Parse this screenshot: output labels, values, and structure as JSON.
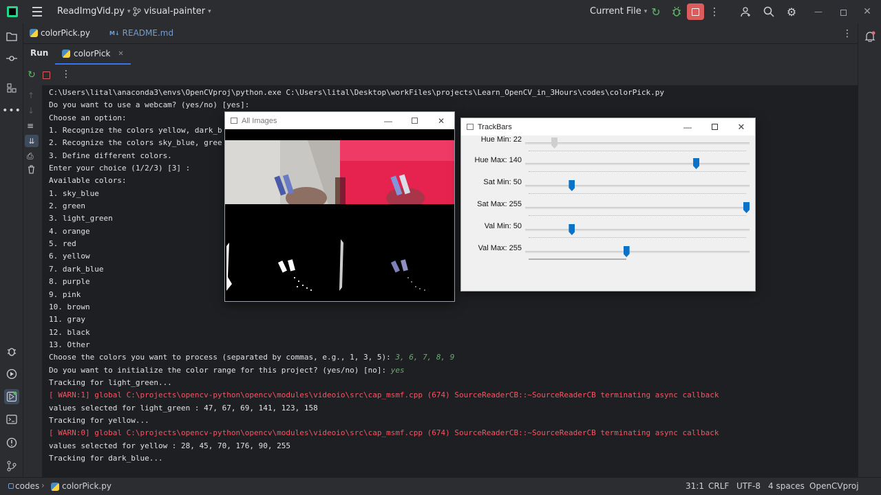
{
  "topbar": {
    "project_file": "ReadImgVid.py",
    "branch": "visual-painter",
    "run_config": "Current File"
  },
  "editor_tabs": [
    {
      "label": "colorPick.py",
      "active": true
    },
    {
      "label": "README.md",
      "active": false
    }
  ],
  "run_panel": {
    "title": "Run",
    "tab_label": "colorPick"
  },
  "console": {
    "lines": [
      {
        "text": "C:\\Users\\lital\\anaconda3\\envs\\OpenCVproj\\python.exe C:\\Users\\lital\\Desktop\\workFiles\\projects\\Learn_OpenCV_in_3Hours\\codes\\colorPick.py",
        "input": ""
      },
      {
        "text": "Do you want to use a webcam? (yes/no) [yes]:",
        "input": ""
      },
      {
        "text": "Choose an option:",
        "input": ""
      },
      {
        "text": "1. Recognize the colors yellow, dark_b",
        "input": ""
      },
      {
        "text": "2. Recognize the colors sky_blue, gree",
        "input": ""
      },
      {
        "text": "3. Define different colors.",
        "input": ""
      },
      {
        "text": "Enter your choice (1/2/3) [3] :",
        "input": ""
      },
      {
        "text": "Available colors:",
        "input": ""
      },
      {
        "text": "1. sky_blue",
        "input": ""
      },
      {
        "text": "2. green",
        "input": ""
      },
      {
        "text": "3. light_green",
        "input": ""
      },
      {
        "text": "4. orange",
        "input": ""
      },
      {
        "text": "5. red",
        "input": ""
      },
      {
        "text": "6. yellow",
        "input": ""
      },
      {
        "text": "7. dark_blue",
        "input": ""
      },
      {
        "text": "8. purple",
        "input": ""
      },
      {
        "text": "9. pink",
        "input": ""
      },
      {
        "text": "10. brown",
        "input": ""
      },
      {
        "text": "11. gray",
        "input": ""
      },
      {
        "text": "12. black",
        "input": ""
      },
      {
        "text": "13. Other",
        "input": ""
      },
      {
        "text": "Choose the colors you want to process (separated by commas, e.g., 1, 3, 5): ",
        "input": "3, 6, 7, 8, 9"
      },
      {
        "text": "Do you want to initialize the color range for this project? (yes/no) [no]: ",
        "input": "yes"
      },
      {
        "text": "Tracking for light_green...",
        "input": ""
      },
      {
        "text": "[ WARN:1] global C:\\projects\\opencv-python\\opencv\\modules\\videoio\\src\\cap_msmf.cpp (674) SourceReaderCB::~SourceReaderCB terminating async callback",
        "input": "",
        "warn": true
      },
      {
        "text": "values selected for light_green : 47, 67, 69, 141, 123, 158",
        "input": ""
      },
      {
        "text": "Tracking for yellow...",
        "input": ""
      },
      {
        "text": "[ WARN:0] global C:\\projects\\opencv-python\\opencv\\modules\\videoio\\src\\cap_msmf.cpp (674) SourceReaderCB::~SourceReaderCB terminating async callback",
        "input": "",
        "warn": true
      },
      {
        "text": "values selected for yellow : 28, 45, 70, 176, 90, 255",
        "input": ""
      },
      {
        "text": "Tracking for dark_blue...",
        "input": ""
      }
    ]
  },
  "all_images_window": {
    "title": "All Images"
  },
  "trackbars_window": {
    "title": "TrackBars",
    "bars": [
      {
        "label": "Hue Min: 22",
        "fraction": 0.12,
        "disabled": true
      },
      {
        "label": "Hue Max: 140",
        "fraction": 0.77,
        "disabled": false
      },
      {
        "label": "Sat Min: 50",
        "fraction": 0.2,
        "disabled": false
      },
      {
        "label": "Sat Max: 255",
        "fraction": 1.0,
        "disabled": false
      },
      {
        "label": "Val Min: 50",
        "fraction": 0.2,
        "disabled": false
      },
      {
        "label": "Val Max: 255",
        "fraction": 0.45,
        "disabled": false
      }
    ]
  },
  "statusbar": {
    "crumb_root": "codes",
    "crumb_file": "colorPick.py",
    "position": "31:1",
    "line_sep": "CRLF",
    "encoding": "UTF-8",
    "indent": "4 spaces",
    "interpreter": "OpenCVproj"
  }
}
